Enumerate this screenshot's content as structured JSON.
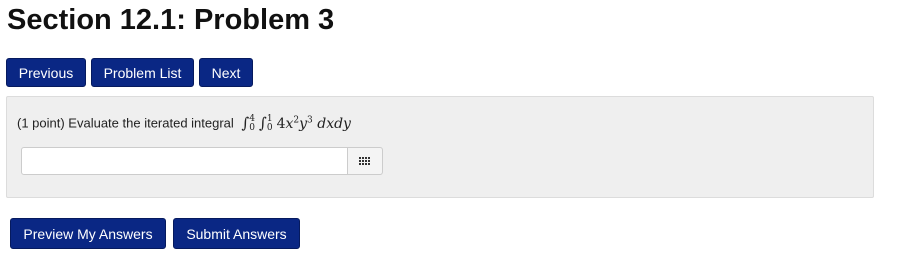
{
  "header": {
    "title": "Section 12.1: Problem 3"
  },
  "nav": {
    "previous_label": "Previous",
    "problem_list_label": "Problem List",
    "next_label": "Next"
  },
  "problem": {
    "prefix": "(1 point) Evaluate the iterated integral",
    "integral_outer_upper": "4",
    "integral_outer_lower": "0",
    "integral_inner_upper": "1",
    "integral_inner_lower": "0",
    "integrand_coefficient": "4",
    "integrand_var_x": "x",
    "integrand_exp_x": "2",
    "integrand_var_y": "y",
    "integrand_exp_y": "3",
    "differentials": "dxdy"
  },
  "answer": {
    "value": "",
    "equation_editor_icon": "grid-icon"
  },
  "actions": {
    "preview_label": "Preview My Answers",
    "submit_label": "Submit Answers"
  },
  "colors": {
    "button_bg": "#0a2784",
    "panel_bg": "#efefef"
  }
}
